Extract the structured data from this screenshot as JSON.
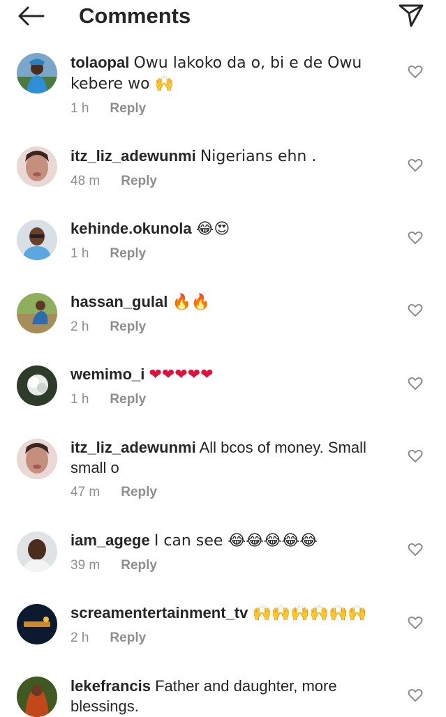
{
  "header": {
    "title": "Comments",
    "back_icon": "arrow-left-icon",
    "send_icon": "paper-plane-icon"
  },
  "reply_label": "Reply",
  "comments": [
    {
      "username": "tolaopal",
      "text": "Owu  lakoko  da o,  bi e de Owu kebere  wo 🙌",
      "time": "1 h"
    },
    {
      "username": "itz_liz_adewunmi",
      "text": "Nigerians ehn .",
      "time": "48 m"
    },
    {
      "username": "kehinde.okunola",
      "text": "😂😍",
      "time": "1 h"
    },
    {
      "username": "hassan_gulal",
      "text": "🔥🔥",
      "time": "2 h"
    },
    {
      "username": "wemimo_i",
      "text": "❤❤❤❤❤",
      "time": "1 h"
    },
    {
      "username": "itz_liz_adewunmi",
      "text": "All bcos of money. Small small o",
      "time": "47 m"
    },
    {
      "username": "iam_agege",
      "text": "I can see 😂😂😂😂😂",
      "time": "39 m"
    },
    {
      "username": "screamentertainment_tv",
      "text": "🙌🙌🙌🙌🙌🙌",
      "time": "2 h"
    },
    {
      "username": "lekefrancis",
      "text": "Father and daughter, more blessings.",
      "time": ""
    }
  ],
  "colors": {
    "text": "#262626",
    "secondary": "#8e8e8e",
    "heart": "#dc143c"
  }
}
